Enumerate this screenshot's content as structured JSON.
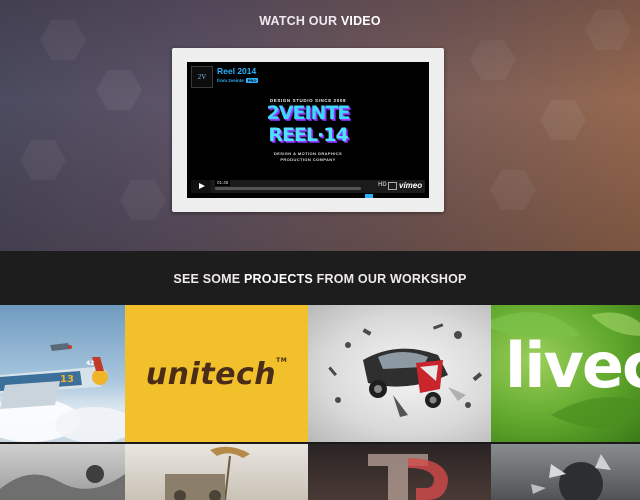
{
  "video_section": {
    "heading_prefix": "WATCH OUR ",
    "heading_bold": "VIDEO",
    "player": {
      "logo_text": "2V",
      "title": "Reel 2014",
      "from_user": "from 2veinte",
      "badge": "PRO",
      "tagline_top": "DESIGN STUDIO SINCE 2008",
      "big_line1": "2VEINTE",
      "big_line2": "REEL·14",
      "tagline_bottom_1": "DESIGN & MOTION GRAPHICS",
      "tagline_bottom_2": "PRODUCTION COMPANY",
      "time": "01:48",
      "hd_label": "HD",
      "vimeo_label": "vimeo",
      "progress_fraction": 0.0
    }
  },
  "projects_section": {
    "heading_prefix": "SEE SOME ",
    "heading_bold": "PROJECTS",
    "heading_suffix": " FROM OUR WORKSHOP",
    "tiles": [
      {
        "kind": "airplane-illustration"
      },
      {
        "kind": "logo",
        "text": "unitech",
        "tm": "TM"
      },
      {
        "kind": "car-explosion-illustration"
      },
      {
        "kind": "logo",
        "text": "livec"
      },
      {
        "kind": "image"
      },
      {
        "kind": "image"
      },
      {
        "kind": "image"
      },
      {
        "kind": "image"
      }
    ]
  },
  "colors": {
    "accent_blue": "#2bb3ff",
    "unitech_yellow": "#f2c02b",
    "band_dark": "#1d1d1d"
  }
}
